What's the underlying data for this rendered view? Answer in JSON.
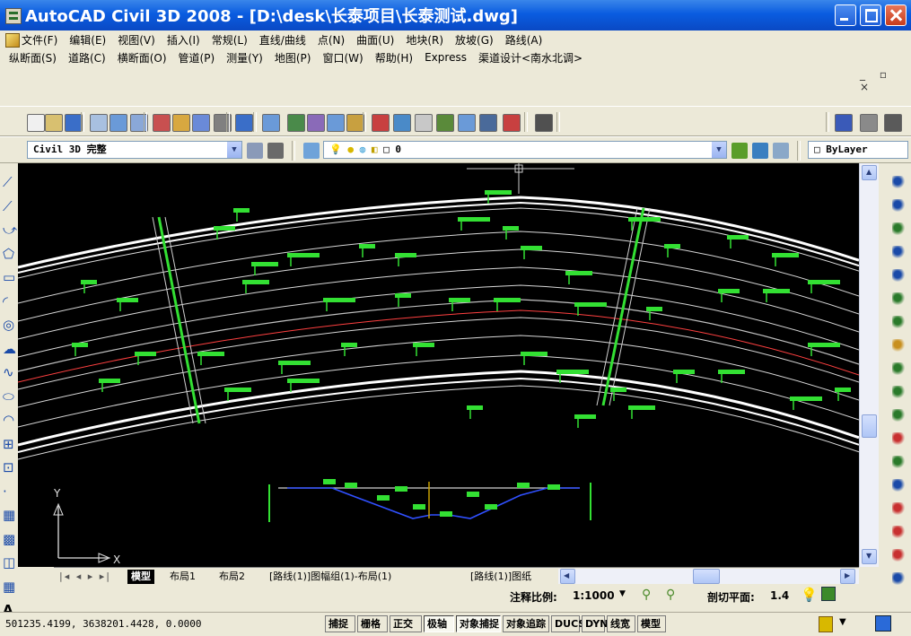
{
  "window": {
    "title": "AutoCAD Civil 3D 2008 - [D:\\desk\\长泰项目\\长泰测试.dwg]"
  },
  "menu": {
    "row1": [
      "文件(F)",
      "编辑(E)",
      "视图(V)",
      "插入(I)",
      "常规(L)",
      "直线/曲线",
      "点(N)",
      "曲面(U)",
      "地块(R)",
      "放坡(G)",
      "路线(A)"
    ],
    "row2": [
      "纵断面(S)",
      "道路(C)",
      "横断面(O)",
      "管道(P)",
      "测量(Y)",
      "地图(P)",
      "窗口(W)",
      "帮助(H)",
      "Express",
      "渠道设计<南水北调>"
    ]
  },
  "toolbar": {
    "workspace": "Civil 3D 完整",
    "layer": "0",
    "linetype": "ByLayer"
  },
  "drawing": {
    "ucs_y": "Y",
    "ucs_x": "X"
  },
  "tabs": [
    "模型",
    "布局1",
    "布局2",
    "[路线(1)]图幅组(1)-布局(1)",
    "[路线(1)]图纸"
  ],
  "annotation": {
    "scale_label": "注释比例:",
    "scale_value": "1:1000",
    "section_label": "剖切平面:",
    "section_value": "1.4"
  },
  "status": {
    "coordinates": "501235.4199, 3638201.4428, 0.0000",
    "buttons": [
      "捕捉",
      "栅格",
      "正交",
      "极轴",
      "对象捕捉",
      "对象追踪",
      "DUCS",
      "DYN",
      "线宽",
      "模型"
    ]
  },
  "colors": {
    "titlebar": "#0a5ce0",
    "canvas": "#000000",
    "annotation_green": "#33e033"
  }
}
